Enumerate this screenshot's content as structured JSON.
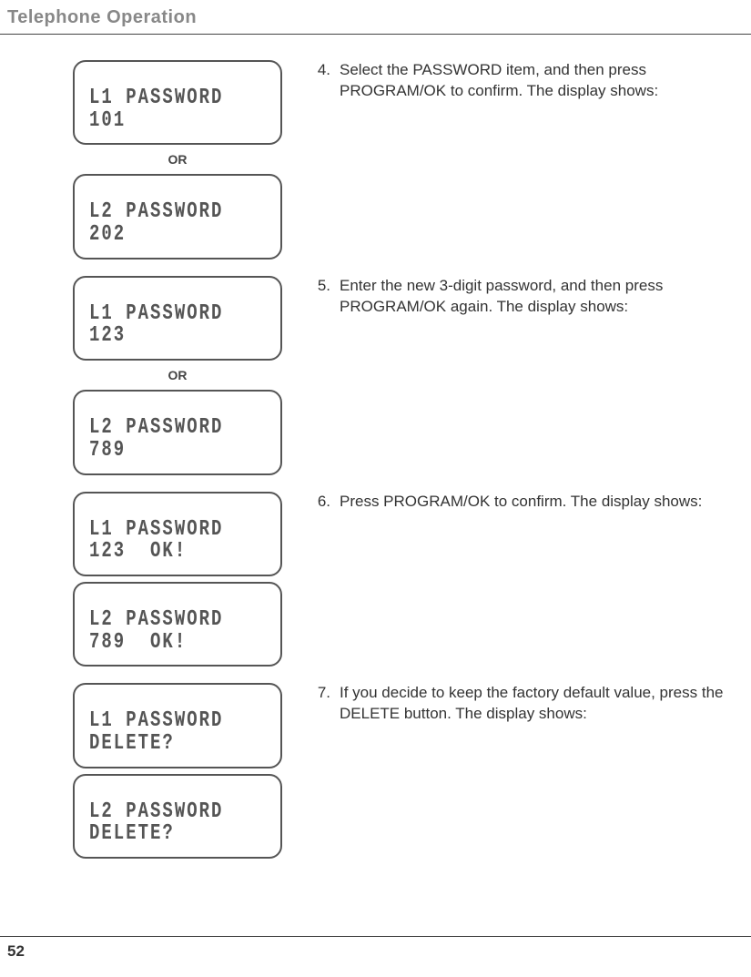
{
  "header": {
    "section_title": "Telephone Operation"
  },
  "steps": [
    {
      "num": "4.",
      "text": "Select the PASSWORD item, and then press PROGRAM/OK to confirm. The display shows:",
      "lcds": [
        {
          "line1": "L1 PASSWORD",
          "line2": "101"
        },
        {
          "separator": "OR"
        },
        {
          "line1": "L2 PASSWORD",
          "line2": "202"
        }
      ]
    },
    {
      "num": "5.",
      "text": "Enter the new 3-digit password, and then press PROGRAM/OK again. The display shows:",
      "lcds": [
        {
          "line1": "L1 PASSWORD",
          "line2": "123"
        },
        {
          "separator": "OR"
        },
        {
          "line1": "L2 PASSWORD",
          "line2": "789"
        }
      ]
    },
    {
      "num": "6.",
      "text": "Press PROGRAM/OK to confirm. The display shows:",
      "lcds": [
        {
          "line1": "L1 PASSWORD",
          "line2": "123  OK!"
        },
        {
          "line1": "L2 PASSWORD",
          "line2": "789  OK!"
        }
      ]
    },
    {
      "num": "7.",
      "text": "If you decide to keep the factory default value, press the DELETE button. The display shows:",
      "lcds": [
        {
          "line1": "L1 PASSWORD",
          "line2": "DELETE?"
        },
        {
          "line1": "L2 PASSWORD",
          "line2": "DELETE?"
        }
      ]
    }
  ],
  "footer": {
    "page_number": "52"
  }
}
